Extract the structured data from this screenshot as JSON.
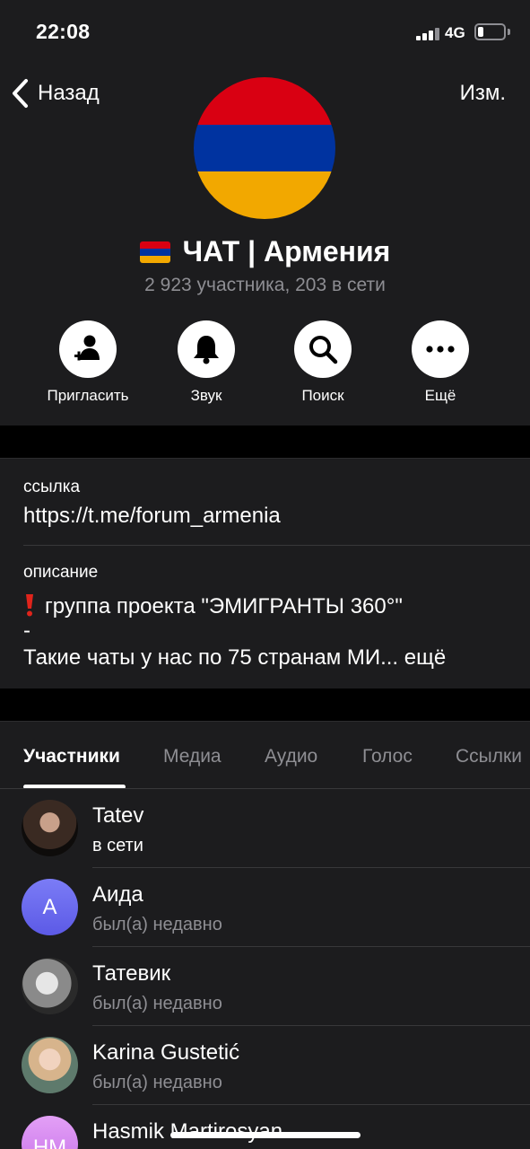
{
  "status_bar": {
    "time": "22:08",
    "network": "4G",
    "battery_level": 0.18
  },
  "nav": {
    "back_label": "Назад",
    "edit_label": "Изм."
  },
  "chat": {
    "title": "ЧАТ | Армения",
    "subtitle": "2 923 участника, 203 в сети",
    "flag_colors": [
      "#d90012",
      "#0033a0",
      "#f2a800"
    ]
  },
  "actions": [
    {
      "label": "Пригласить",
      "icon": "add-user-icon"
    },
    {
      "label": "Звук",
      "icon": "bell-icon"
    },
    {
      "label": "Поиск",
      "icon": "search-icon"
    },
    {
      "label": "Ещё",
      "icon": "more-icon"
    }
  ],
  "info": {
    "link_label": "ссылка",
    "link_value": "https://t.me/forum_armenia",
    "description_label": "описание",
    "description_line1": "группа проекта \"ЭМИГРАНТЫ 360°\"",
    "description_line2": "-",
    "description_line3": "Такие чаты у нас по 75 странам МИ...",
    "more_label": "ещё"
  },
  "tabs": [
    "Участники",
    "Медиа",
    "Аудио",
    "Голос",
    "Ссылки"
  ],
  "members": [
    {
      "name": "Tatev",
      "status": "в сети",
      "online": true,
      "avatar_type": "photo"
    },
    {
      "name": "Аида",
      "status": "был(а) недавно",
      "online": false,
      "avatar_type": "initials",
      "initials": "А"
    },
    {
      "name": "Татевик",
      "status": "был(а) недавно",
      "online": false,
      "avatar_type": "photo"
    },
    {
      "name": "Karina Gustetić",
      "status": "был(а) недавно",
      "online": false,
      "avatar_type": "photo"
    },
    {
      "name": "Hasmik Martirosyan",
      "status": "",
      "online": false,
      "avatar_type": "initials",
      "initials": "HM"
    }
  ],
  "colors": {
    "accent": "#ffffff",
    "background": "#1c1c1e",
    "secondary_text": "#8e8e93",
    "avatar_aida": "#6d6cf2",
    "avatar_hm": "#d58af0"
  }
}
